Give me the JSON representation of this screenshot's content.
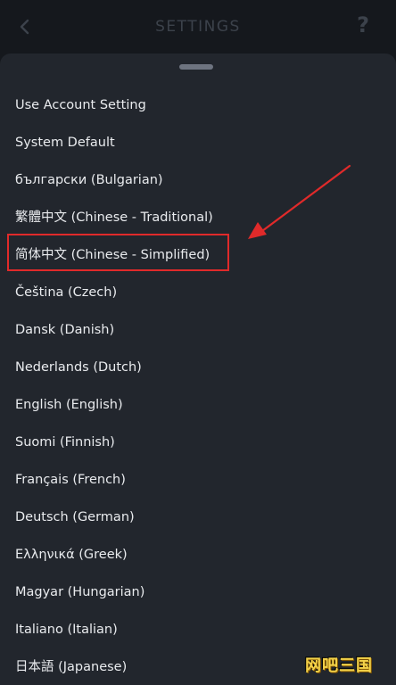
{
  "header": {
    "title": "SETTINGS",
    "help_label": "?"
  },
  "languages": [
    {
      "label": "Use Account Setting"
    },
    {
      "label": "System Default"
    },
    {
      "label": "български (Bulgarian)"
    },
    {
      "label": "繁體中文 (Chinese - Traditional)"
    },
    {
      "label": "简体中文 (Chinese - Simplified)",
      "highlighted": true
    },
    {
      "label": "Čeština (Czech)"
    },
    {
      "label": "Dansk (Danish)"
    },
    {
      "label": "Nederlands (Dutch)"
    },
    {
      "label": "English (English)"
    },
    {
      "label": "Suomi (Finnish)"
    },
    {
      "label": "Français (French)"
    },
    {
      "label": "Deutsch (German)"
    },
    {
      "label": "Ελληνικά (Greek)"
    },
    {
      "label": "Magyar (Hungarian)"
    },
    {
      "label": "Italiano (Italian)"
    },
    {
      "label": "日本語 (Japanese)"
    }
  ],
  "annotation": {
    "color": "#e02a2a"
  },
  "watermark": {
    "text": "网吧三国"
  },
  "icons": {
    "back": "chevron-left-icon",
    "help": "question-mark-icon"
  }
}
